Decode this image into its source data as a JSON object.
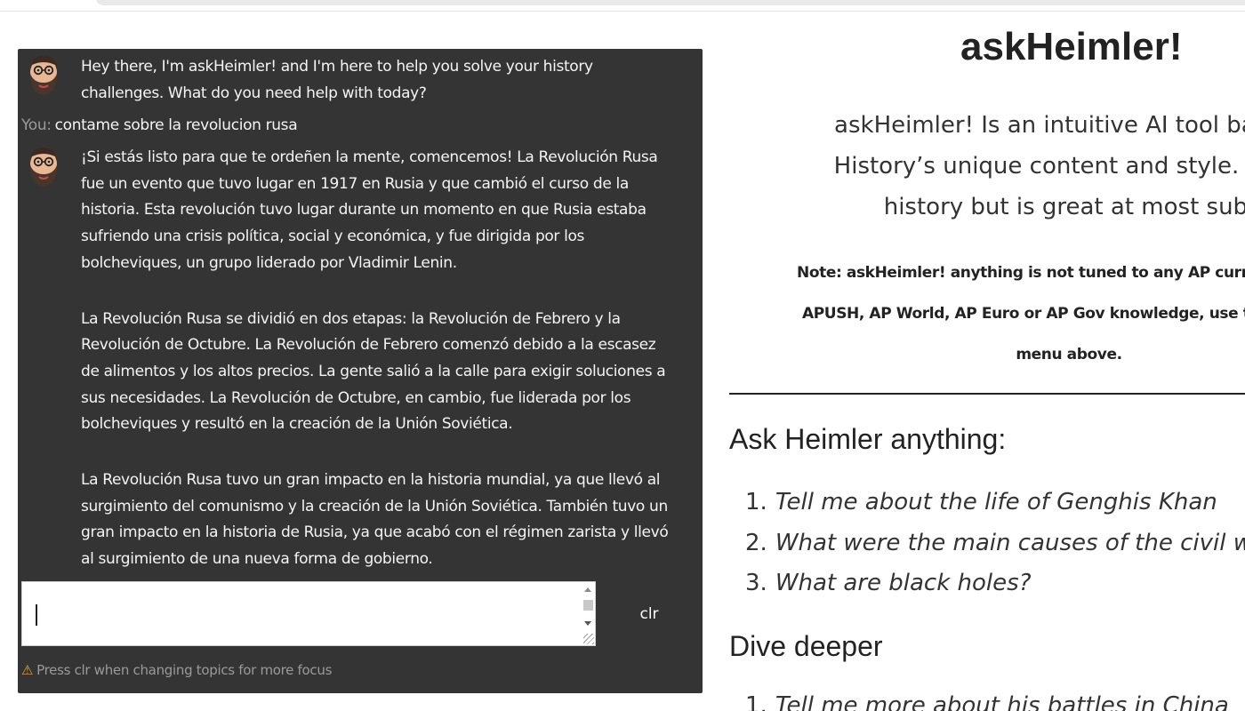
{
  "chat": {
    "greeting_lines": [
      "Hey there, I'm askHeimler! and I'm here to help you solve your history",
      "challenges. What do you need help with today?"
    ],
    "user_label": "You:",
    "user_message": "contame sobre la revolucion rusa",
    "response_paragraphs": [
      [
        "¡Si estás listo para que te ordeñen la mente, comencemos! La Revolución Rusa",
        "fue un evento que tuvo lugar en 1917 en Rusia y que cambió el curso de la",
        "historia. Esta revolución tuvo lugar durante un momento en que Rusia estaba",
        "sufriendo una crisis política, social y económica, y fue dirigida por los",
        "bolcheviques, un grupo liderado por Vladimir Lenin."
      ],
      [
        "La Revolución Rusa se dividió en dos etapas: la Revolución de Febrero y la",
        "Revolución de Octubre. La Revolución de Febrero comenzó debido a la escasez",
        "de alimentos y los altos precios. La gente salió a la calle para exigir soluciones a",
        "sus necesidades. La Revolución de Octubre, en cambio, fue liderada por los",
        "bolcheviques y resultó en la creación de la Unión Soviética."
      ],
      [
        "La Revolución Rusa tuvo un gran impacto en la historia mundial, ya que llevó al",
        "surgimiento del comunismo y la creación de la Unión Soviética. También tuvo un",
        "gran impacto en la historia de Rusia, ya que acabó con el régimen zarista y llevó",
        "al surgimiento de una nueva forma de gobierno."
      ]
    ],
    "input_value": "",
    "clear_button_label": "clr",
    "hint_text": "Press clr when changing topics for more focus",
    "hint_icon": "warning-icon"
  },
  "sidebar": {
    "title": "askHeimler!",
    "intro_lines": [
      "askHeimler! Is an intuitive AI tool based o",
      "History’s unique content and style. It’s fin",
      "history but is great at most subje"
    ],
    "note_lines": [
      "Note: askHeimler! anything is not tuned to any AP curriculums. Fo",
      "APUSH, AP World, AP Euro or AP Gov knowledge, use the course-",
      "menu above."
    ],
    "ask_heading": "Ask Heimler anything:",
    "ask_questions": [
      "Tell me about the life of Genghis Khan",
      "What were the main causes of the civil war",
      "What are black holes?"
    ],
    "dive_heading": "Dive deeper",
    "dive_questions": [
      "Tell me more about his battles in China"
    ]
  },
  "colors": {
    "chat_background": "#343434",
    "chat_text": "#f4f4f4",
    "muted_text": "#9a9a9a",
    "warning": "#e0a53a"
  }
}
